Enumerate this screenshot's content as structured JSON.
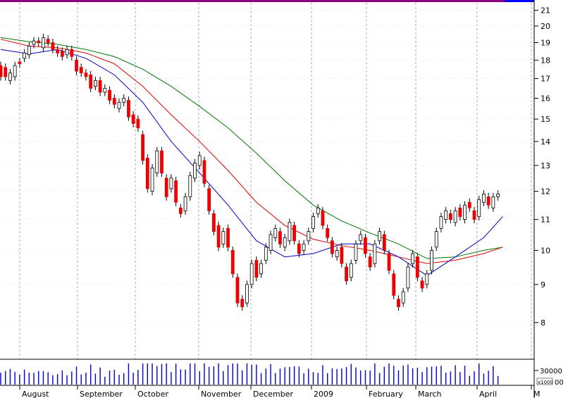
{
  "chart_data": {
    "type": "candlestick",
    "colors": {
      "up": "#ffffff",
      "down": "#ee0000",
      "ma_short": "#0000cc",
      "ma_mid": "#dd0000",
      "ma_long": "#007700",
      "volume": "#0000cc",
      "top_bar": "#8b0080",
      "grid": "#aaaaaa"
    },
    "y_axis": {
      "scale": "log",
      "ylim": [
        7.3,
        21.3
      ],
      "ticks": [
        "8",
        "9",
        "10",
        "11",
        "12",
        "13",
        "14",
        "15",
        "16",
        "17",
        "18",
        "19",
        "20",
        "21"
      ]
    },
    "x_axis": {
      "labels": [
        "August",
        "September",
        "October",
        "November",
        "December",
        "2009",
        "February",
        "March",
        "April",
        "M"
      ]
    },
    "volume_axis": {
      "label": "30000",
      "unit_label": "x1000",
      "zero_label": "00"
    },
    "price_series": [
      [
        17.7,
        17.1
      ],
      [
        17.6,
        17.1
      ],
      [
        16.9,
        17.3
      ],
      [
        17.1,
        17.7
      ],
      [
        17.9,
        17.8
      ],
      [
        18.1,
        18.4
      ],
      [
        18.3,
        18.8
      ],
      [
        18.9,
        19.1
      ],
      [
        19.1,
        19.0
      ],
      [
        18.7,
        19.3
      ],
      [
        19.2,
        19.0
      ],
      [
        19.0,
        18.6
      ],
      [
        18.6,
        18.4
      ],
      [
        18.5,
        18.2
      ],
      [
        18.3,
        18.6
      ],
      [
        18.6,
        18.2
      ],
      [
        18.0,
        17.4
      ],
      [
        17.6,
        17.3
      ],
      [
        17.3,
        17.1
      ],
      [
        17.2,
        16.5
      ],
      [
        16.6,
        16.9
      ],
      [
        16.9,
        16.3
      ],
      [
        16.3,
        16.5
      ],
      [
        16.4,
        15.9
      ],
      [
        16.0,
        15.7
      ],
      [
        15.5,
        15.8
      ],
      [
        15.8,
        16.0
      ],
      [
        15.9,
        15.1
      ],
      [
        15.2,
        14.8
      ],
      [
        15.0,
        14.6
      ],
      [
        14.3,
        13.2
      ],
      [
        13.3,
        12.1
      ],
      [
        12.0,
        12.9
      ],
      [
        12.7,
        13.6
      ],
      [
        13.6,
        12.7
      ],
      [
        12.5,
        11.8
      ],
      [
        12.1,
        12.5
      ],
      [
        12.4,
        11.6
      ],
      [
        11.4,
        11.2
      ],
      [
        11.3,
        11.8
      ],
      [
        11.8,
        12.6
      ],
      [
        12.5,
        13.1
      ],
      [
        13.0,
        13.4
      ],
      [
        13.2,
        12.3
      ],
      [
        12.1,
        11.3
      ],
      [
        11.2,
        10.6
      ],
      [
        10.8,
        10.1
      ],
      [
        10.2,
        10.6
      ],
      [
        10.7,
        10.1
      ],
      [
        10.0,
        9.3
      ],
      [
        9.2,
        8.5
      ],
      [
        8.6,
        8.4
      ],
      [
        8.5,
        9.0
      ],
      [
        9.0,
        9.6
      ],
      [
        9.7,
        9.2
      ],
      [
        9.3,
        9.6
      ],
      [
        9.7,
        10.1
      ],
      [
        10.0,
        10.5
      ],
      [
        10.4,
        10.7
      ],
      [
        10.6,
        10.2
      ],
      [
        10.1,
        10.4
      ],
      [
        10.3,
        10.9
      ],
      [
        10.8,
        10.3
      ],
      [
        10.2,
        9.9
      ],
      [
        10.0,
        10.2
      ],
      [
        10.3,
        10.6
      ],
      [
        10.7,
        11.1
      ],
      [
        11.2,
        11.4
      ],
      [
        11.3,
        10.8
      ],
      [
        10.7,
        10.4
      ],
      [
        10.3,
        9.9
      ],
      [
        9.8,
        10.0
      ],
      [
        10.1,
        9.6
      ],
      [
        9.5,
        9.1
      ],
      [
        9.2,
        9.6
      ],
      [
        9.7,
        10.2
      ],
      [
        10.3,
        10.5
      ],
      [
        10.4,
        9.9
      ],
      [
        9.8,
        9.5
      ],
      [
        9.6,
        10.2
      ],
      [
        10.3,
        10.6
      ],
      [
        10.5,
        10.0
      ],
      [
        9.9,
        9.4
      ],
      [
        9.3,
        8.7
      ],
      [
        8.6,
        8.4
      ],
      [
        8.5,
        8.8
      ],
      [
        8.9,
        9.5
      ],
      [
        9.6,
        9.9
      ],
      [
        9.8,
        9.2
      ],
      [
        9.1,
        8.9
      ],
      [
        9.0,
        9.3
      ],
      [
        9.4,
        10.0
      ],
      [
        10.1,
        10.6
      ],
      [
        10.7,
        11.1
      ],
      [
        11.0,
        11.3
      ],
      [
        11.2,
        11.0
      ],
      [
        10.9,
        11.3
      ],
      [
        11.4,
        11.1
      ],
      [
        11.0,
        11.5
      ],
      [
        11.6,
        11.4
      ],
      [
        11.3,
        11.0
      ],
      [
        11.1,
        11.7
      ],
      [
        11.6,
        11.9
      ],
      [
        11.8,
        11.5
      ],
      [
        11.4,
        11.8
      ],
      [
        11.8,
        11.9
      ]
    ],
    "ma_short": [
      [
        0,
        18.6
      ],
      [
        6,
        18.35
      ],
      [
        12,
        18.6
      ],
      [
        18,
        18.1
      ],
      [
        24,
        17.2
      ],
      [
        30,
        15.8
      ],
      [
        36,
        14.0
      ],
      [
        42,
        12.7
      ],
      [
        48,
        11.5
      ],
      [
        54,
        10.3
      ],
      [
        60,
        9.8
      ],
      [
        66,
        9.9
      ],
      [
        72,
        10.2
      ],
      [
        78,
        10.2
      ],
      [
        84,
        9.8
      ],
      [
        90,
        9.25
      ],
      [
        96,
        9.8
      ],
      [
        102,
        10.4
      ],
      [
        106,
        11.1
      ]
    ],
    "ma_mid": [
      [
        0,
        19.2
      ],
      [
        6,
        18.8
      ],
      [
        12,
        18.7
      ],
      [
        18,
        18.4
      ],
      [
        24,
        17.8
      ],
      [
        30,
        16.6
      ],
      [
        36,
        15.2
      ],
      [
        42,
        14.0
      ],
      [
        48,
        12.8
      ],
      [
        54,
        11.6
      ],
      [
        60,
        10.8
      ],
      [
        66,
        10.35
      ],
      [
        72,
        10.15
      ],
      [
        78,
        10.0
      ],
      [
        84,
        9.8
      ],
      [
        90,
        9.6
      ],
      [
        96,
        9.7
      ],
      [
        102,
        9.9
      ],
      [
        106,
        10.1
      ]
    ],
    "ma_long": [
      [
        0,
        19.3
      ],
      [
        6,
        19.05
      ],
      [
        12,
        18.9
      ],
      [
        18,
        18.6
      ],
      [
        24,
        18.2
      ],
      [
        30,
        17.5
      ],
      [
        36,
        16.6
      ],
      [
        42,
        15.6
      ],
      [
        48,
        14.6
      ],
      [
        54,
        13.5
      ],
      [
        60,
        12.4
      ],
      [
        66,
        11.5
      ],
      [
        72,
        10.95
      ],
      [
        78,
        10.55
      ],
      [
        84,
        10.2
      ],
      [
        90,
        9.75
      ],
      [
        96,
        9.8
      ],
      [
        102,
        10.0
      ],
      [
        106,
        10.1
      ]
    ]
  }
}
